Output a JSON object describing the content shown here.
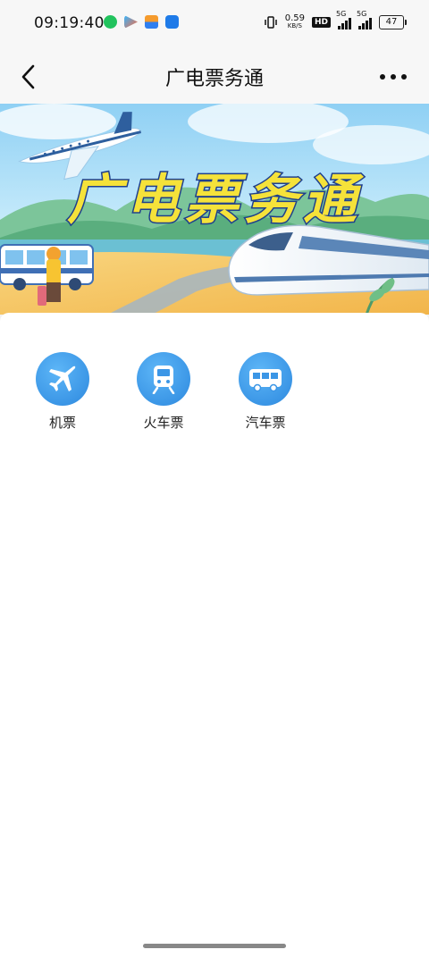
{
  "status_bar": {
    "time": "09:19:40",
    "net_speed_value": "0.59",
    "net_speed_unit": "KB/S",
    "hd_label": "HD",
    "signal1_label": "5G",
    "signal2_label": "5G",
    "battery": "47"
  },
  "nav": {
    "title": "广电票务通",
    "back_icon": "chevron-left-icon",
    "more_icon": "more-horizontal-icon"
  },
  "banner": {
    "title": "广电票务通"
  },
  "menu": {
    "items": [
      {
        "label": "机票",
        "icon": "airplane-icon"
      },
      {
        "label": "火车票",
        "icon": "train-icon"
      },
      {
        "label": "汽车票",
        "icon": "bus-icon"
      }
    ]
  },
  "colors": {
    "accent": "#3b96e6",
    "banner_title": "#f5e23a",
    "background": "#ffffff"
  }
}
